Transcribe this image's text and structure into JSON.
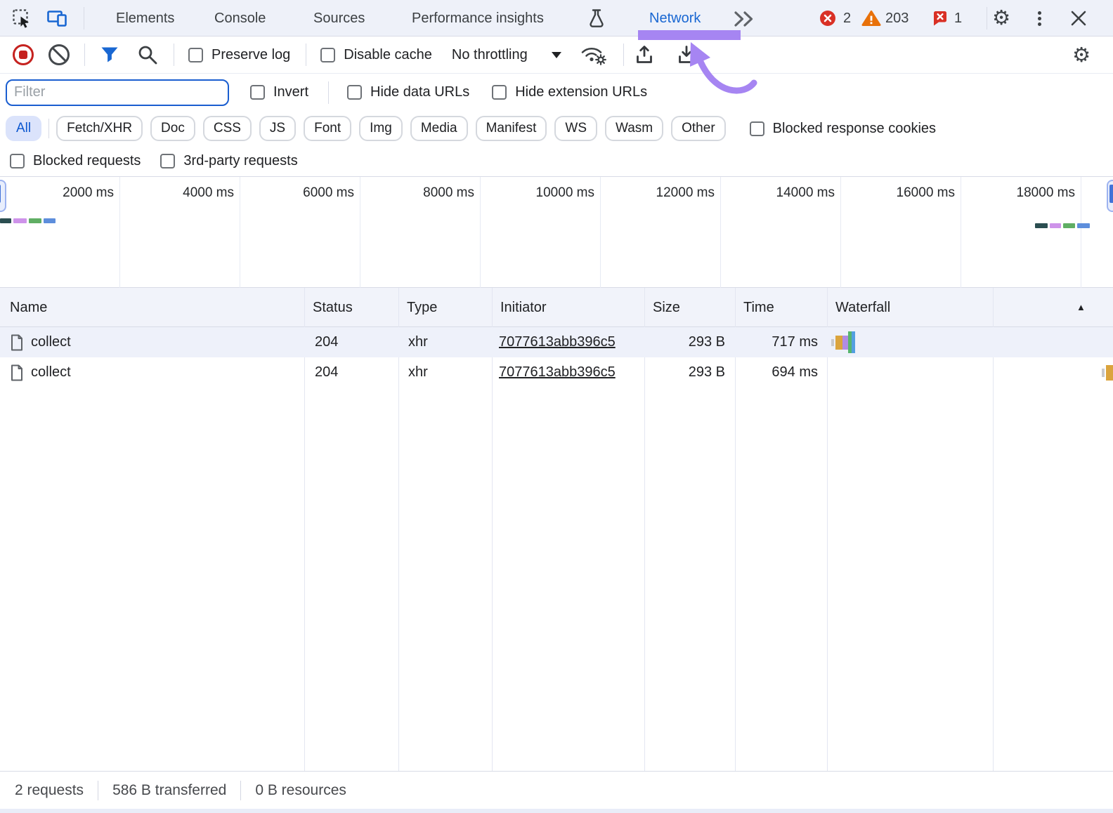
{
  "tabbar": {
    "tabs": [
      {
        "label": "Elements",
        "active": false
      },
      {
        "label": "Console",
        "active": false
      },
      {
        "label": "Sources",
        "active": false
      },
      {
        "label": "Performance insights",
        "active": false
      },
      {
        "label": "Network",
        "active": true
      }
    ],
    "error_count": "2",
    "warning_count": "203",
    "issue_count": "1"
  },
  "icons": {
    "gear": "⚙"
  },
  "toolbar": {
    "preserve_log_label": "Preserve log",
    "disable_cache_label": "Disable cache",
    "throttling_value": "No throttling"
  },
  "filterbar": {
    "filter_placeholder": "Filter",
    "invert_label": "Invert",
    "hide_data_urls_label": "Hide data URLs",
    "hide_extension_urls_label": "Hide extension URLs",
    "chips": [
      "All",
      "Fetch/XHR",
      "Doc",
      "CSS",
      "JS",
      "Font",
      "Img",
      "Media",
      "Manifest",
      "WS",
      "Wasm",
      "Other"
    ],
    "selected_chip": "All",
    "blocked_response_cookies_label": "Blocked response cookies",
    "blocked_requests_label": "Blocked requests",
    "third_party_label": "3rd-party requests"
  },
  "overview": {
    "tick_labels": [
      "2000 ms",
      "4000 ms",
      "6000 ms",
      "8000 ms",
      "10000 ms",
      "12000 ms",
      "14000 ms",
      "16000 ms",
      "18000 ms"
    ],
    "bar_colors": [
      "#2b4e51",
      "#ce93ea",
      "#60ae64",
      "#5d8edc"
    ]
  },
  "table": {
    "columns": [
      "Name",
      "Status",
      "Type",
      "Initiator",
      "Size",
      "Time",
      "Waterfall"
    ],
    "sort_indicator": "▲",
    "rows": [
      {
        "name": "collect",
        "status": "204",
        "type": "xhr",
        "initiator": "7077613abb396c5",
        "size": "293 B",
        "time": "717 ms",
        "waterfall_segments": [
          "#c9cacd",
          "#dba43d",
          "#b18ce4",
          "#57b56d",
          "#539fe0"
        ]
      },
      {
        "name": "collect",
        "status": "204",
        "type": "xhr",
        "initiator": "7077613abb396c5",
        "size": "293 B",
        "time": "694 ms",
        "waterfall_segments": [
          "#c9cacd",
          "#dba43d"
        ]
      }
    ]
  },
  "statusbar": {
    "requests": "2 requests",
    "transferred": "586 B transferred",
    "resources": "0 B resources"
  },
  "colors": {
    "annotation_purple": "#a685f2",
    "accent_blue": "#1967d2",
    "error_red": "#d93025",
    "warning_orange": "#e8710a",
    "selected_chip_bg": "#dbe3fb",
    "row_stripe": "#eef1fa"
  }
}
